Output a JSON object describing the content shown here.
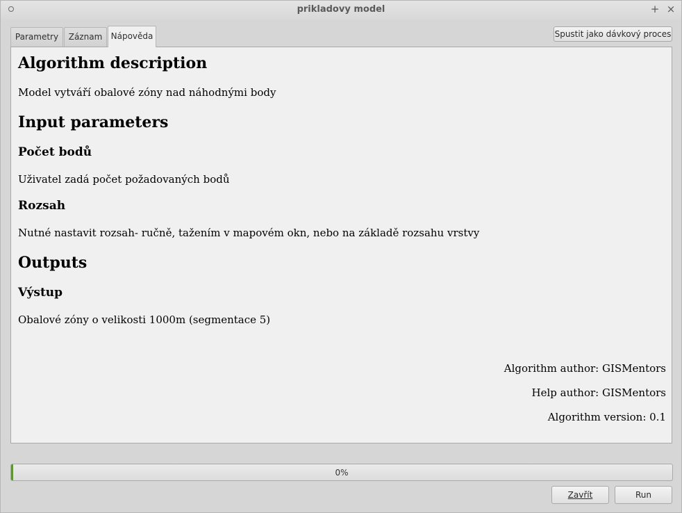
{
  "window": {
    "title": "prikladovy model",
    "maximize_glyph": "+",
    "close_glyph": "×"
  },
  "tabs": [
    {
      "label": "Parametry",
      "active": false
    },
    {
      "label": "Záznam",
      "active": false
    },
    {
      "label": "Nápověda",
      "active": true
    }
  ],
  "batch_button": "Spustit jako dávkový proces",
  "help": {
    "algorithm_heading": "Algorithm description",
    "algorithm_text": "Model vytváří obalové zóny nad náhodnými body",
    "inputs_heading": "Input parameters",
    "param1_name": "Počet bodů",
    "param1_text": "Uživatel zadá počet požadovaných bodů",
    "param2_name": "Rozsah",
    "param2_text": "Nutné nastavit rozsah- ručně, tažením v mapovém okn, nebo na základě rozsahu vrstvy",
    "outputs_heading": "Outputs",
    "output1_name": "Výstup",
    "output1_text": "Obalové zóny o velikosti 1000m (segmentace 5)",
    "algorithm_author": "Algorithm author: GISMentors",
    "help_author": "Help author: GISMentors",
    "algorithm_version": "Algorithm version: 0.1"
  },
  "progress": {
    "value": 0,
    "label": "0%",
    "color": "#5f9438"
  },
  "buttons": {
    "close": "Zavřít",
    "run": "Run"
  }
}
